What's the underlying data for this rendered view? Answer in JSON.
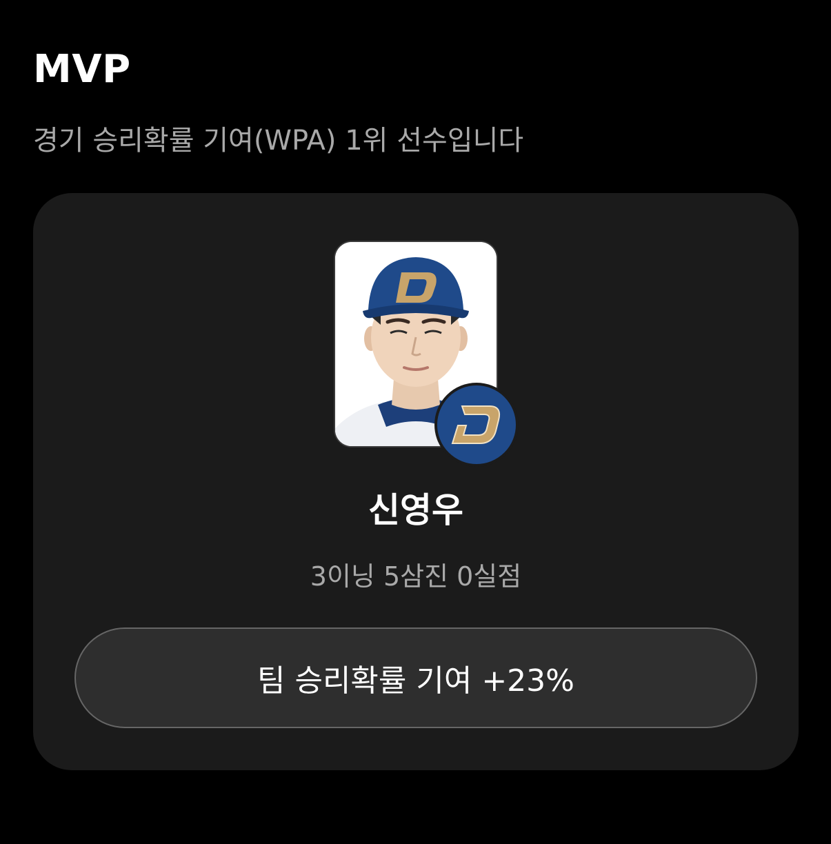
{
  "section": {
    "title": "MVP",
    "subtitle": "경기 승리확률 기여(WPA) 1위 선수입니다"
  },
  "player": {
    "name": "신영우",
    "stats": "3이닝 5삼진 0실점",
    "photo_icon": "player-photo",
    "team_logo_icon": "team-logo-icon"
  },
  "wpa": {
    "label": "팀 승리확률 기여 +23%"
  },
  "colors": {
    "background": "#000000",
    "card": "#1b1b1b",
    "button": "#2e2e2e",
    "team_navy": "#1f4a8a",
    "team_gold": "#c8a46a",
    "muted_text": "#a9a9a9"
  }
}
